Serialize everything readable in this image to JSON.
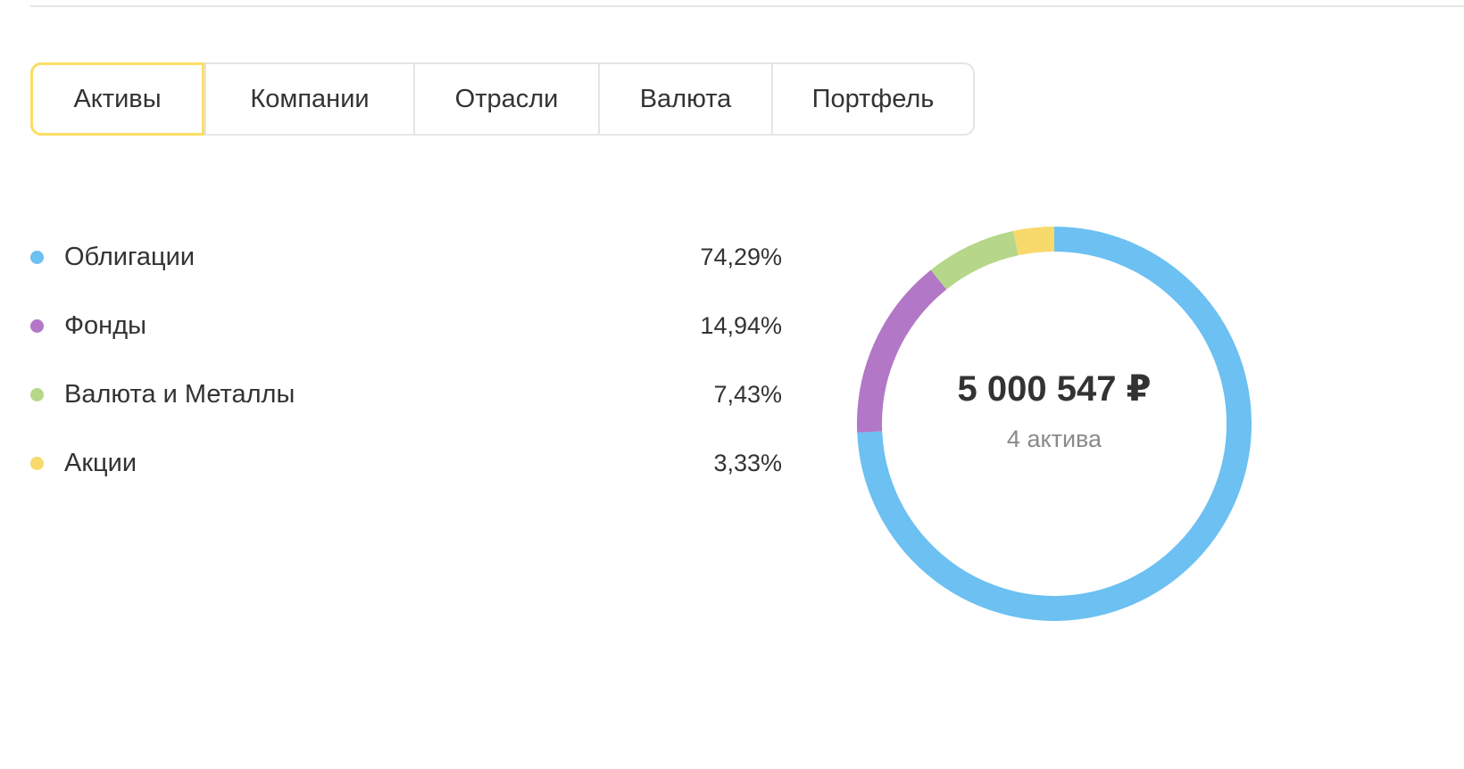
{
  "tabs": [
    {
      "label": "Активы",
      "active": true
    },
    {
      "label": "Компании",
      "active": false
    },
    {
      "label": "Отрасли",
      "active": false
    },
    {
      "label": "Валюта",
      "active": false
    },
    {
      "label": "Портфель",
      "active": false
    }
  ],
  "legend": [
    {
      "label": "Облигации",
      "value": "74,29%",
      "color": "#6cc0f2"
    },
    {
      "label": "Фонды",
      "value": "14,94%",
      "color": "#b277c6"
    },
    {
      "label": "Валюта и Металлы",
      "value": "7,43%",
      "color": "#b6d78a"
    },
    {
      "label": "Акции",
      "value": "3,33%",
      "color": "#f8d96b"
    }
  ],
  "donut": {
    "total": "5 000 547 ₽",
    "subtitle": "4 актива"
  },
  "chart_data": {
    "type": "pie",
    "categories": [
      "Облигации",
      "Фонды",
      "Валюта и Металлы",
      "Акции"
    ],
    "values": [
      74.29,
      14.94,
      7.43,
      3.33
    ],
    "colors": [
      "#6cc0f2",
      "#b277c6",
      "#b6d78a",
      "#f8d96b"
    ],
    "center_label": "5 000 547 ₽",
    "center_sublabel": "4 актива"
  }
}
